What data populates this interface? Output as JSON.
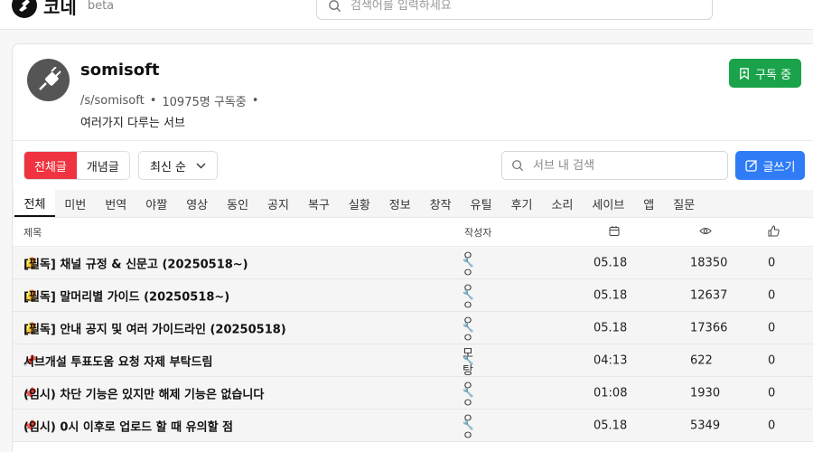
{
  "app": {
    "logo_text": "코네",
    "beta": "beta"
  },
  "global_search": {
    "placeholder": "검색어를 입력하세요"
  },
  "sub": {
    "name": "somisoft",
    "path": "/s/somisoft",
    "subscribers": "10975명 구독중",
    "description": "여러가지 다루는 서브",
    "subscribe_label": "구독 중"
  },
  "toolbar": {
    "filter_all": "전체글",
    "filter_concept": "개념글",
    "sort_label": "최신 순",
    "board_search_placeholder": "서브 내 검색",
    "write_label": "글쓰기"
  },
  "tabs": [
    "전체",
    "미번",
    "번역",
    "야짤",
    "영상",
    "동인",
    "공지",
    "복구",
    "실황",
    "정보",
    "창작",
    "유틸",
    "후기",
    "소리",
    "세이브",
    "앱",
    "질문"
  ],
  "columns": {
    "title": "제목",
    "author": "작성자"
  },
  "posts": [
    {
      "bell": true,
      "title": "[필독] 채널 규정 & 신문고 (20250518~)",
      "author": "ㅇㅇ",
      "date": "05.18",
      "views": "18350",
      "likes": "0"
    },
    {
      "bell": true,
      "title": "[필독] 말머리별 가이드 (20250518~)",
      "author": "ㅇㅇ",
      "date": "05.18",
      "views": "12637",
      "likes": "0"
    },
    {
      "bell": true,
      "title": "[필독] 안내 공지 및 여러 가이드라인 (20250518)",
      "author": "ㅇㅇ",
      "date": "05.18",
      "views": "17366",
      "likes": "0"
    },
    {
      "bell": false,
      "title": "서브개설 투표도움 요청 자제 부탁드림",
      "author": "모탕",
      "date": "04:13",
      "views": "622",
      "likes": "0"
    },
    {
      "bell": false,
      "title": "(임시) 차단 기능은 있지만 해제 기능은 없습니다",
      "author": "ㅇㅇ",
      "date": "01:08",
      "views": "1930",
      "likes": "0"
    },
    {
      "bell": false,
      "title": "(임시) 0시 이후로 업로드 할 때 유의할 점",
      "author": "ㅇㅇ",
      "date": "05.18",
      "views": "5349",
      "likes": "0"
    }
  ],
  "colors": {
    "filter_active": "#ef3340",
    "subscribe": "#1aa34a",
    "write": "#2f7cf6",
    "mod_wrench": "#e8922a"
  },
  "icons": [
    "logo-icon",
    "search-icon",
    "plug-icon",
    "bookmark-icon",
    "chevron-down-icon",
    "edit-icon",
    "calendar-icon",
    "eye-icon",
    "thumbs-up-icon",
    "pin-icon",
    "bell-icon",
    "wrench-icon"
  ]
}
